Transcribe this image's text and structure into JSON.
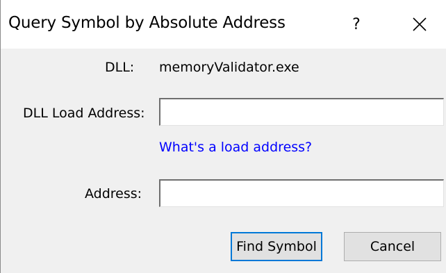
{
  "window": {
    "title": "Query Symbol by Absolute Address",
    "help_label": "?",
    "close_label": "✕"
  },
  "form": {
    "dll_label": "DLL:",
    "dll_value": "memoryValidator.exe",
    "load_address_label": "DLL Load Address:",
    "load_address_value": "",
    "load_address_help_link": "What's a load address?",
    "address_label": "Address:",
    "address_value": ""
  },
  "buttons": {
    "find_symbol": "Find Symbol",
    "cancel": "Cancel"
  },
  "colors": {
    "link": "#0000ff",
    "default_button_border": "#0078d7",
    "dialog_background": "#f0f0f0",
    "titlebar_background": "#ffffff"
  }
}
